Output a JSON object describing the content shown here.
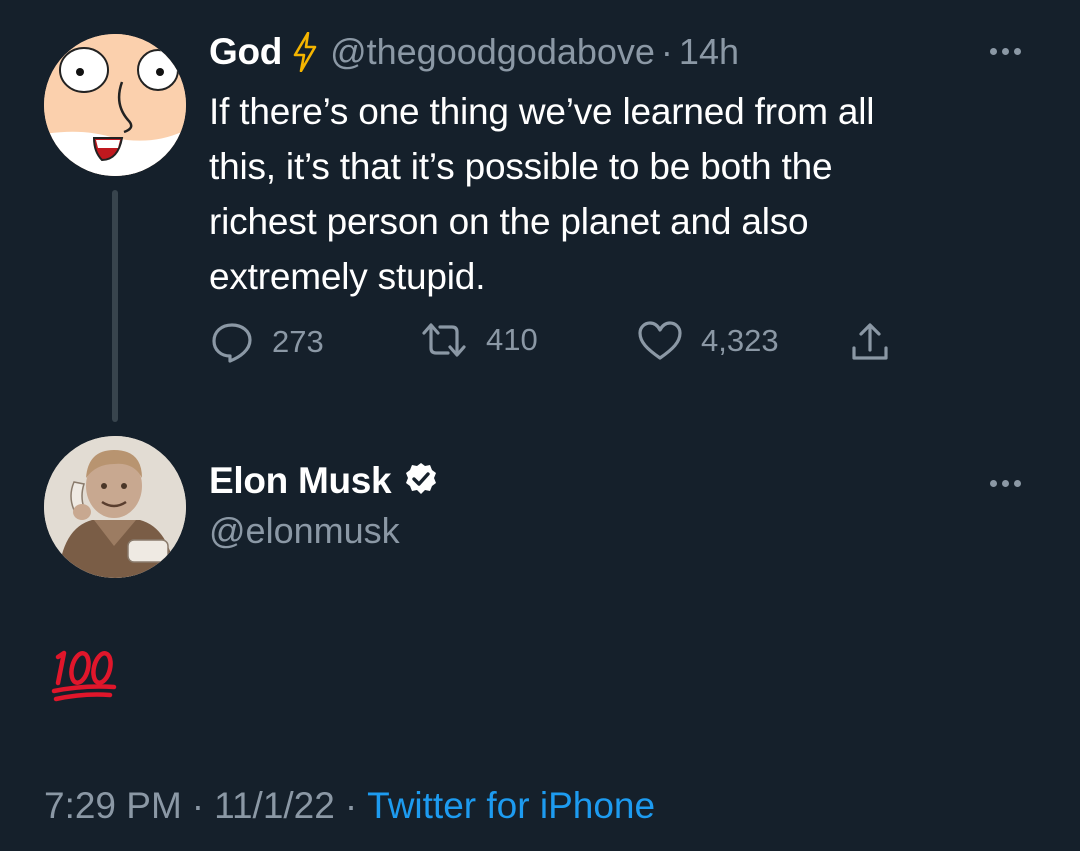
{
  "parent_tweet": {
    "display_name": "God",
    "name_badge_icon": "lightning-bolt-icon",
    "handle": "@thegoodgodabove",
    "separator": "·",
    "time_ago": "14h",
    "text_lines": [
      "If there’s one thing we’ve learned from all",
      "this, it’s that it’s possible to be both the",
      "richest person on the planet and also",
      "extremely stupid."
    ],
    "stats": {
      "replies": "273",
      "retweets": "410",
      "likes": "4,323"
    }
  },
  "reply_tweet": {
    "display_name": "Elon Musk",
    "verified_icon": "verified-badge-icon",
    "handle": "@elonmusk",
    "body_emoji": "hundred-points-emoji",
    "timestamp_time": "7:29 PM",
    "separator": "·",
    "timestamp_date": "11/1/22",
    "source": "Twitter for iPhone"
  },
  "colors": {
    "background": "#15202b",
    "text_primary": "#ffffff",
    "text_secondary": "#8b98a5",
    "link": "#1d9bf0",
    "bolt": "#f4b400",
    "hundred_red": "#e0162b"
  }
}
